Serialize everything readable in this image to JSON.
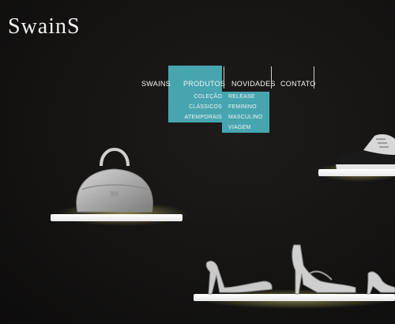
{
  "brand": {
    "logo_text": "SwainS"
  },
  "nav": {
    "items": [
      {
        "label": "SWAINS"
      },
      {
        "label": "PRODUTOS"
      },
      {
        "label": "NOVIDADES"
      },
      {
        "label": "CONTATO"
      }
    ],
    "active_index": 1,
    "accent_color": "#47a5b0"
  },
  "dropdowns": {
    "produtos": [
      "COLEÇÃO",
      "CLÁSSICOS",
      "ATEMPORAIS"
    ],
    "novidades": [
      "RELEASE",
      "FEMININO",
      "MASCULINO",
      "VIAGEM"
    ]
  },
  "products": {
    "handbag": {
      "icon": "handbag-icon"
    },
    "sneaker": {
      "icon": "shoe-icon"
    },
    "heel_1": {
      "icon": "high-heel-icon"
    },
    "heel_2": {
      "icon": "high-heel-icon"
    },
    "heel_3": {
      "icon": "high-heel-icon"
    }
  }
}
